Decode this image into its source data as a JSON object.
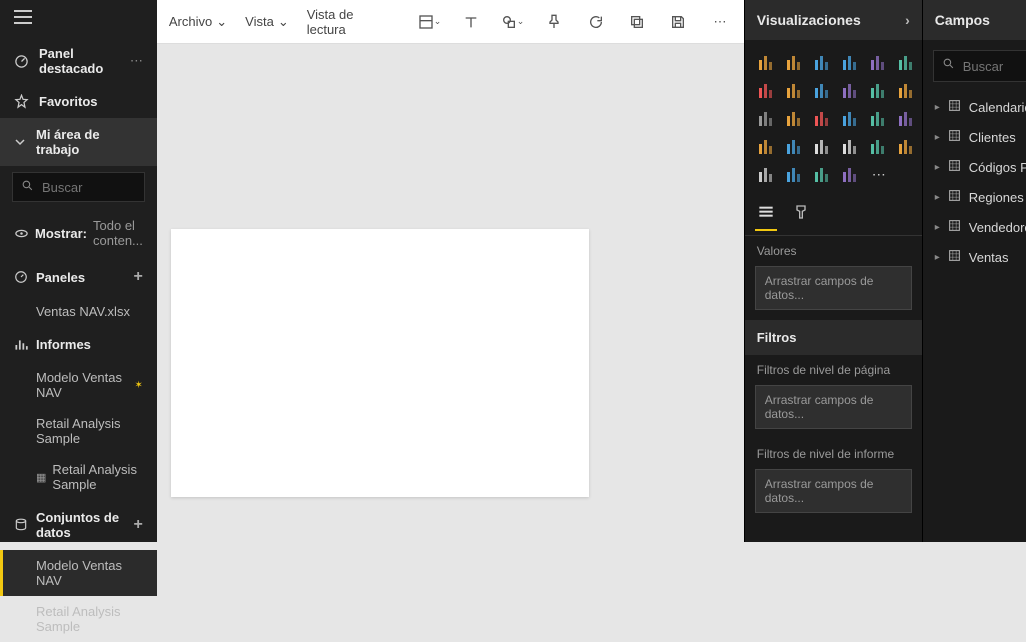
{
  "sidebar": {
    "featured": "Panel destacado",
    "favorites": "Favoritos",
    "workspace": "Mi área de trabajo",
    "search_placeholder": "Buscar",
    "show_label": "Mostrar:",
    "show_value": "Todo el conten...",
    "sections": {
      "dashboards": {
        "label": "Paneles",
        "items": [
          "Ventas NAV.xlsx"
        ]
      },
      "reports": {
        "label": "Informes",
        "items": [
          "Modelo Ventas NAV",
          "Retail Analysis Sample",
          "Retail Analysis Sample"
        ]
      },
      "datasets": {
        "label": "Conjuntos de datos",
        "items": [
          "Modelo Ventas NAV",
          "Retail Analysis Sample"
        ]
      }
    }
  },
  "menubar": {
    "file": "Archivo",
    "view": "Vista",
    "reading": "Vista de lectura"
  },
  "viz_panel": {
    "title": "Visualizaciones",
    "values_label": "Valores",
    "drop_placeholder": "Arrastrar campos de datos...",
    "filters_title": "Filtros",
    "page_filters": "Filtros de nivel de página",
    "report_filters": "Filtros de nivel de informe",
    "icons": [
      "stacked-bar",
      "stacked-column",
      "clustered-bar",
      "clustered-column",
      "100-bar",
      "100-column",
      "line",
      "area",
      "stacked-area",
      "line-clustered",
      "line-stacked",
      "ribbon",
      "scatter",
      "pie",
      "donut",
      "treemap",
      "map",
      "filled-map",
      "funnel",
      "gauge",
      "card",
      "multi-card",
      "kpi",
      "slicer",
      "table",
      "matrix",
      "r-visual",
      "arcgis",
      "more-ellipsis",
      "blank"
    ]
  },
  "fields_panel": {
    "title": "Campos",
    "search_placeholder": "Buscar",
    "tables": [
      "Calendario",
      "Clientes",
      "Códigos Postales",
      "Regiones",
      "Vendedores",
      "Ventas"
    ]
  },
  "colors": {
    "accent": "#f2c811"
  }
}
